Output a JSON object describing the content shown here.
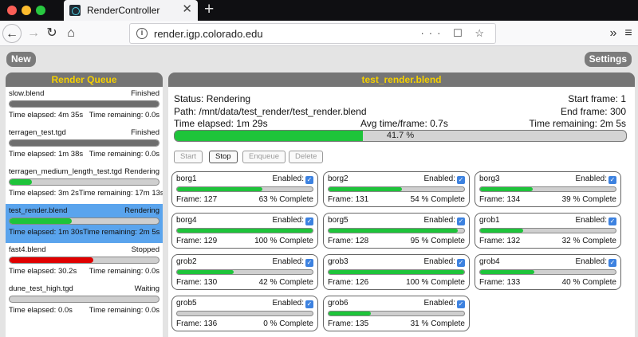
{
  "browser": {
    "tab_title": "RenderController",
    "tab_close": "✕",
    "new_tab": "+",
    "url": "render.igp.colorado.edu",
    "back": "←",
    "forward": "→",
    "reload": "↻",
    "home": "⌂",
    "url_info": "i",
    "url_actions": "··· ☐ ☆",
    "overflow": "»",
    "menu": "≡"
  },
  "app": {
    "new_label": "New",
    "settings_label": "Settings"
  },
  "queue": {
    "title": "Render Queue",
    "items": [
      {
        "name": "slow.blend",
        "status": "Finished",
        "elapsed": "Time elapsed: 4m 35s",
        "remaining": "Time remaining: 0.0s",
        "progress": 1.0,
        "color": "#6e6e6e"
      },
      {
        "name": "terragen_test.tgd",
        "status": "Finished",
        "elapsed": "Time elapsed: 1m 38s",
        "remaining": "Time remaining: 0.0s",
        "progress": 1.0,
        "color": "#6e6e6e"
      },
      {
        "name": "terragen_medium_length_test.tgd",
        "status": "Rendering",
        "elapsed": "Time elapsed: 3m 2s",
        "remaining": "Time remaining: 17m 13s",
        "progress": 0.15,
        "color": "#1ec43a"
      },
      {
        "name": "test_render.blend",
        "status": "Rendering",
        "elapsed": "Time elapsed: 1m 30s",
        "remaining": "Time remaining: 2m 5s",
        "progress": 0.417,
        "color": "#1ec43a"
      },
      {
        "name": "fast4.blend",
        "status": "Stopped",
        "elapsed": "Time elapsed: 30.2s",
        "remaining": "Time remaining: 0.0s",
        "progress": 0.56,
        "color": "#e00000"
      },
      {
        "name": "dune_test_high.tgd",
        "status": "Waiting",
        "elapsed": "Time elapsed: 0.0s",
        "remaining": "Time remaining: 0.0s",
        "progress": 0.0,
        "color": "#1ec43a"
      }
    ]
  },
  "job": {
    "title": "test_render.blend",
    "status": "Status: Rendering",
    "path": "Path: /mnt/data/test_render/test_render.blend",
    "elapsed": "Time elapsed: 1m 29s",
    "avg": "Avg time/frame: 0.7s",
    "start_frame": "Start frame: 1",
    "end_frame": "End frame: 300",
    "remaining": "Time remaining: 2m 5s",
    "progress": 0.417,
    "progress_label": "41.7 %",
    "buttons": {
      "start": "Start",
      "stop": "Stop",
      "enqueue": "Enqueue",
      "delete": "Delete"
    }
  },
  "nodes": [
    {
      "name": "borg1",
      "enabled_label": "Enabled:",
      "frame": "Frame: 127",
      "complete": "63 % Complete",
      "progress": 0.63
    },
    {
      "name": "borg2",
      "enabled_label": "Enabled:",
      "frame": "Frame: 131",
      "complete": "54 % Complete",
      "progress": 0.54
    },
    {
      "name": "borg3",
      "enabled_label": "Enabled:",
      "frame": "Frame: 134",
      "complete": "39 % Complete",
      "progress": 0.39
    },
    {
      "name": "borg4",
      "enabled_label": "Enabled:",
      "frame": "Frame: 129",
      "complete": "100 % Complete",
      "progress": 1.0
    },
    {
      "name": "borg5",
      "enabled_label": "Enabled:",
      "frame": "Frame: 128",
      "complete": "95 % Complete",
      "progress": 0.95
    },
    {
      "name": "grob1",
      "enabled_label": "Enabled:",
      "frame": "Frame: 132",
      "complete": "32 % Complete",
      "progress": 0.32
    },
    {
      "name": "grob2",
      "enabled_label": "Enabled:",
      "frame": "Frame: 130",
      "complete": "42 % Complete",
      "progress": 0.42
    },
    {
      "name": "grob3",
      "enabled_label": "Enabled:",
      "frame": "Frame: 126",
      "complete": "100 % Complete",
      "progress": 1.0
    },
    {
      "name": "grob4",
      "enabled_label": "Enabled:",
      "frame": "Frame: 133",
      "complete": "40 % Complete",
      "progress": 0.4
    },
    {
      "name": "grob5",
      "enabled_label": "Enabled:",
      "frame": "Frame: 136",
      "complete": "0 % Complete",
      "progress": 0.0
    },
    {
      "name": "grob6",
      "enabled_label": "Enabled:",
      "frame": "Frame: 135",
      "complete": "31 % Complete",
      "progress": 0.31
    }
  ],
  "colors": {
    "accent": "#f5d000",
    "progress": "#1ec43a",
    "selected": "#5aa4ed",
    "stopped": "#e00000"
  }
}
